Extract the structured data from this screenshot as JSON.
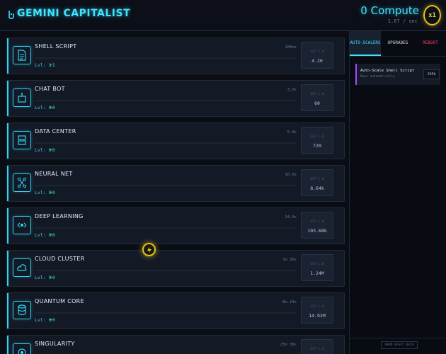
{
  "header": {
    "title": "GEMINI CAPITALIST",
    "compute": "0 Compute",
    "rate": "1.67 / sec",
    "multiplier": "x1"
  },
  "generators": [
    {
      "name": "SHELL SCRIPT",
      "time": "100ms",
      "level": "Lvl: 1",
      "plus": "+1",
      "value_label": "GET 1.0",
      "value": "4.20",
      "icon": "document-icon"
    },
    {
      "name": "CHAT BOT",
      "time": "3.0s",
      "level": "Lvl: 0",
      "plus": "+0",
      "value_label": "GET 1.0",
      "value": "60",
      "icon": "robot-icon"
    },
    {
      "name": "DATA CENTER",
      "time": "5.0s",
      "level": "Lvl: 0",
      "plus": "+0",
      "value_label": "GET 1.0",
      "value": "720",
      "icon": "server-icon"
    },
    {
      "name": "NEURAL NET",
      "time": "10.0s",
      "level": "Lvl: 0",
      "plus": "+0",
      "value_label": "GET 1.0",
      "value": "8.64k",
      "icon": "network-icon"
    },
    {
      "name": "DEEP LEARNING",
      "time": "24.0s",
      "level": "Lvl: 0",
      "plus": "+0",
      "value_label": "GET 1.0",
      "value": "103.68k",
      "icon": "brain-icon"
    },
    {
      "name": "CLOUD CLUSTER",
      "time": "1m 36s",
      "level": "Lvl: 0",
      "plus": "+0",
      "value_label": "GET 1.0",
      "value": "1.24M",
      "icon": "cloud-icon"
    },
    {
      "name": "QUANTUM CORE",
      "time": "6m 24s",
      "level": "Lvl: 0",
      "plus": "+0",
      "value_label": "GET 1.0",
      "value": "14.93M",
      "icon": "database-icon"
    },
    {
      "name": "SINGULARITY",
      "time": "25m 36s",
      "level": "",
      "plus": "",
      "value_label": "GET 1.0",
      "value": "",
      "icon": "target-icon"
    }
  ],
  "sidebar": {
    "tabs": [
      "AUTO-SCALERS",
      "UPGRADES",
      "REBOOT"
    ],
    "upgrade": {
      "title": "Auto-Scale Shell Script",
      "subtitle": "Runs automatically",
      "price": "100k"
    },
    "footer_button": "HARD RESET DATA"
  },
  "colors": {
    "accent": "#3fe2ff",
    "gold": "#e3c21a",
    "reboot": "#ff3b5c",
    "upgrade_border": "#a349ff"
  }
}
